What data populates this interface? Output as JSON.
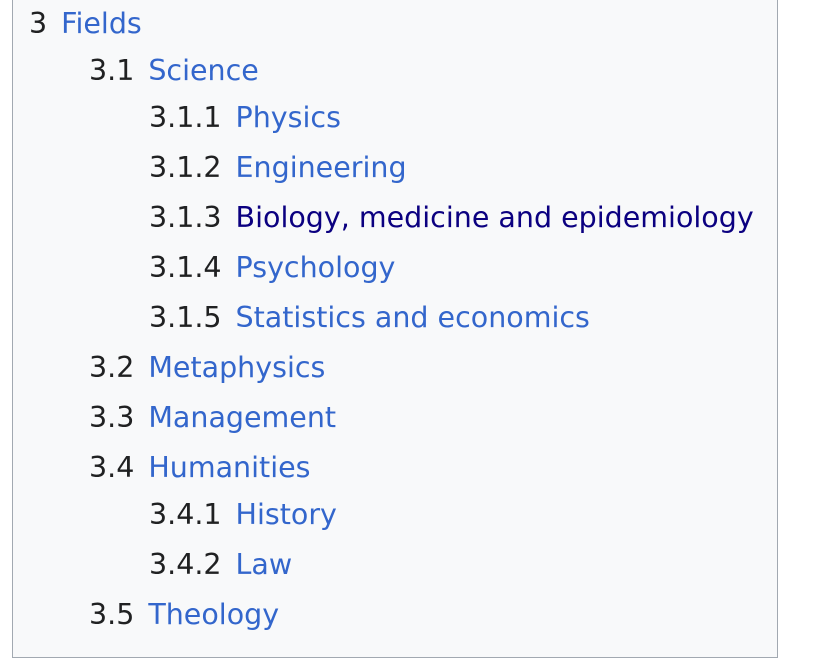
{
  "toc": {
    "items": [
      {
        "number": "3",
        "text": "Fields"
      },
      {
        "number": "3.1",
        "text": "Science"
      },
      {
        "number": "3.1.1",
        "text": "Physics"
      },
      {
        "number": "3.1.2",
        "text": "Engineering"
      },
      {
        "number": "3.1.3",
        "text": "Biology, medicine and epidemiology"
      },
      {
        "number": "3.1.4",
        "text": "Psychology"
      },
      {
        "number": "3.1.5",
        "text": "Statistics and economics"
      },
      {
        "number": "3.2",
        "text": "Metaphysics"
      },
      {
        "number": "3.3",
        "text": "Management"
      },
      {
        "number": "3.4",
        "text": "Humanities"
      },
      {
        "number": "3.4.1",
        "text": "History"
      },
      {
        "number": "3.4.2",
        "text": "Law"
      },
      {
        "number": "3.5",
        "text": "Theology"
      }
    ],
    "colors": {
      "link": "#3366cc",
      "visited_link": "#0b0080",
      "number": "#202122",
      "background": "#f8f9fa",
      "border": "#a2a9b1"
    }
  }
}
